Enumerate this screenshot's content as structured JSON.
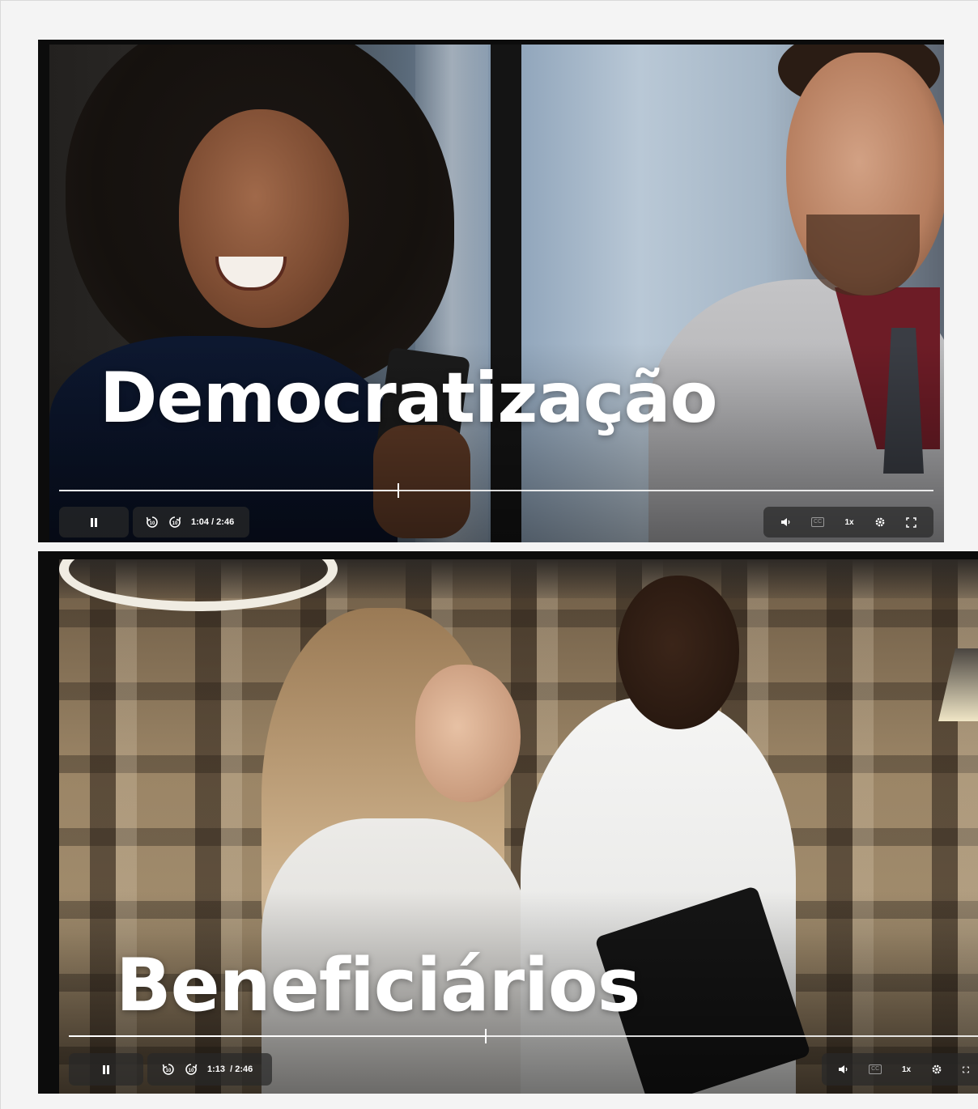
{
  "players": [
    {
      "overlay_title": "Democratização",
      "time_display": "1:04 / 2:46",
      "progress_fraction": 0.385,
      "controls": {
        "skip_back_label": "10",
        "skip_forward_label": "10",
        "cc_label": "CC",
        "speed_label": "1x"
      }
    },
    {
      "overlay_title": "Beneficiários",
      "time_display": "1:13  / 2:46",
      "progress_fraction": 0.44,
      "controls": {
        "skip_back_label": "10",
        "skip_forward_label": "10",
        "cc_label": "CC",
        "speed_label": "1x"
      }
    }
  ],
  "icons": {
    "pause": "pause-icon",
    "rewind": "rewind-10-icon",
    "forward": "forward-10-icon",
    "volume": "volume-icon",
    "captions": "captions-icon",
    "settings": "gear-icon",
    "fullscreen": "fullscreen-icon"
  },
  "colors": {
    "control_bg": "#282828",
    "control_fg": "#ffffff",
    "page_bg": "#f4f4f4"
  }
}
